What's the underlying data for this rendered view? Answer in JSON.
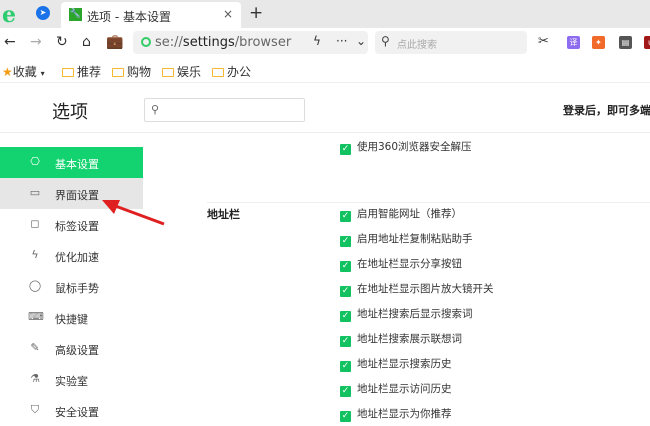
{
  "tabbar": {
    "tab_title": "选项 - 基本设置",
    "close": "×",
    "new_tab": "+"
  },
  "toolbar": {
    "url_prefix": "se://",
    "url_host": "settings",
    "url_path": "/browser",
    "search_placeholder": "点此搜索",
    "more": "···"
  },
  "bookmarks": {
    "favorites": "收藏",
    "folders": [
      "推荐",
      "购物",
      "娱乐",
      "办公"
    ]
  },
  "header": {
    "title": "选项",
    "login_text": "登录后，即可多端"
  },
  "sidebar": {
    "items": [
      {
        "label": "基本设置",
        "icon": "⎔"
      },
      {
        "label": "界面设置",
        "icon": "▭"
      },
      {
        "label": "标签设置",
        "icon": "◻"
      },
      {
        "label": "优化加速",
        "icon": "ϟ"
      },
      {
        "label": "鼠标手势",
        "icon": "◯"
      },
      {
        "label": "快捷键",
        "icon": "⌨"
      },
      {
        "label": "高级设置",
        "icon": "✎"
      },
      {
        "label": "实验室",
        "icon": "⚗"
      },
      {
        "label": "安全设置",
        "icon": "⛉"
      }
    ]
  },
  "main": {
    "top_option": "使用360浏览器安全解压",
    "section_title": "地址栏",
    "options": [
      "启用智能网址（推荐）",
      "启用地址栏复制粘贴助手",
      "在地址栏显示分享按钮",
      "在地址栏显示图片放大镜开关",
      "地址栏搜索后显示搜索词",
      "地址栏搜索展示联想词",
      "地址栏显示搜索历史",
      "地址栏显示访问历史",
      "地址栏显示为你推荐"
    ]
  },
  "colors": {
    "accent": "#12d36f",
    "checkbox": "#12c261",
    "arrow": "#e02020"
  }
}
